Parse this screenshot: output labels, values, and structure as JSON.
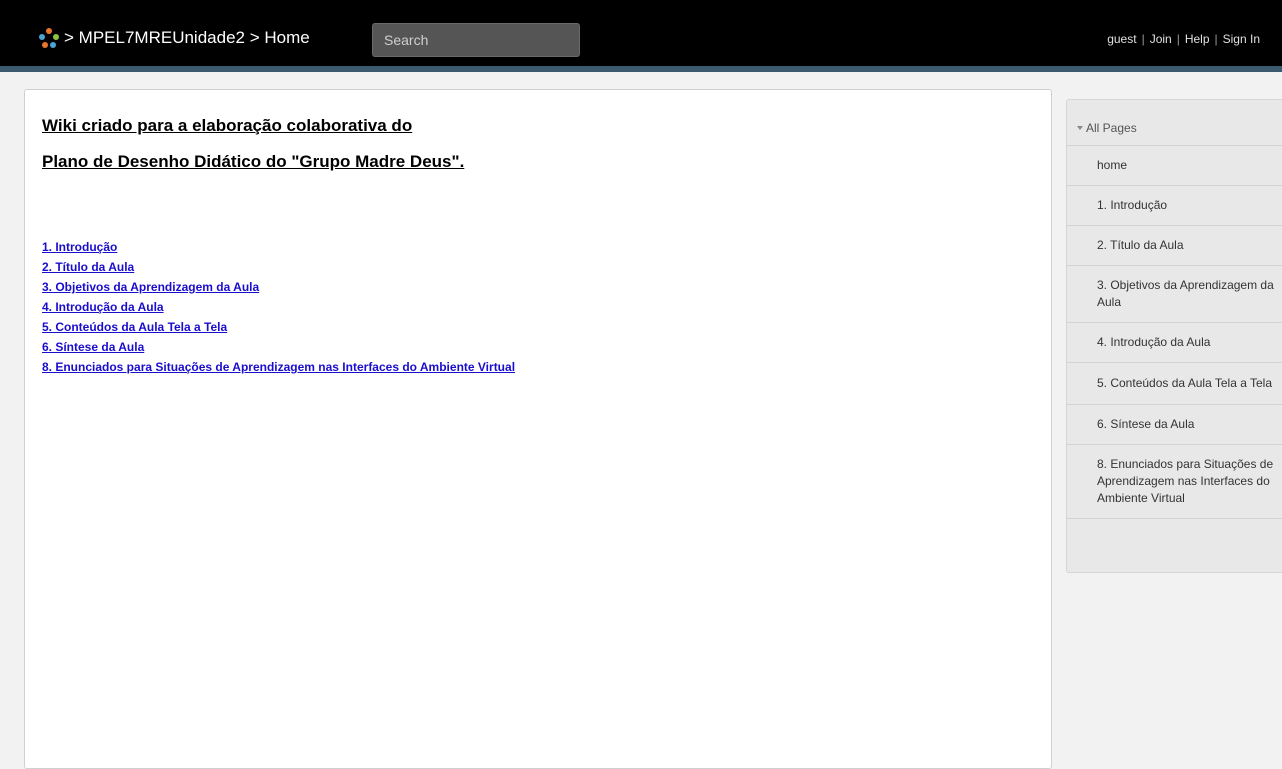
{
  "header": {
    "breadcrumb_separator_1": ">",
    "wiki_name": "MPEL7MREUnidade2",
    "breadcrumb_separator_2": ">",
    "page_name": "Home",
    "search_placeholder": "Search",
    "user": "guest",
    "nav_sep": "|",
    "join": "Join",
    "help": "Help",
    "sign_in": "Sign In"
  },
  "main": {
    "heading_line1": "Wiki criado para a elaboração colaborativa do",
    "heading_line2": "Plano de Desenho Didático do \"Grupo Madre Deus\".",
    "toc": [
      "1. Introdução",
      "2. Título da Aula",
      "3. Objetivos da Aprendizagem da Aula",
      "4. Introdução da Aula",
      "5. Conteúdos da Aula Tela a Tela",
      "6. Síntese da Aula",
      "8. Enunciados para Situações de Aprendizagem nas Interfaces do Ambiente Virtual"
    ]
  },
  "sidebar": {
    "title": "All Pages",
    "items": [
      "home",
      "1. Introdução",
      "2. Título da Aula",
      "3. Objetivos da Aprendizagem da Aula",
      "4. Introdução da Aula",
      "5. Conteúdos da Aula Tela a Tela",
      "6. Síntese da Aula",
      "8. Enunciados para Situações de Aprendizagem nas Interfaces do Ambiente Virtual"
    ]
  },
  "colors": {
    "topbar": "#000000",
    "topbar_accent": "#3b5a6e",
    "link": "#1a0dcc",
    "sidebar_bg": "#e8e8e8"
  },
  "icons": {
    "logo": "wikispaces-logo-icon",
    "all_pages_toggle": "caret-down-icon"
  }
}
